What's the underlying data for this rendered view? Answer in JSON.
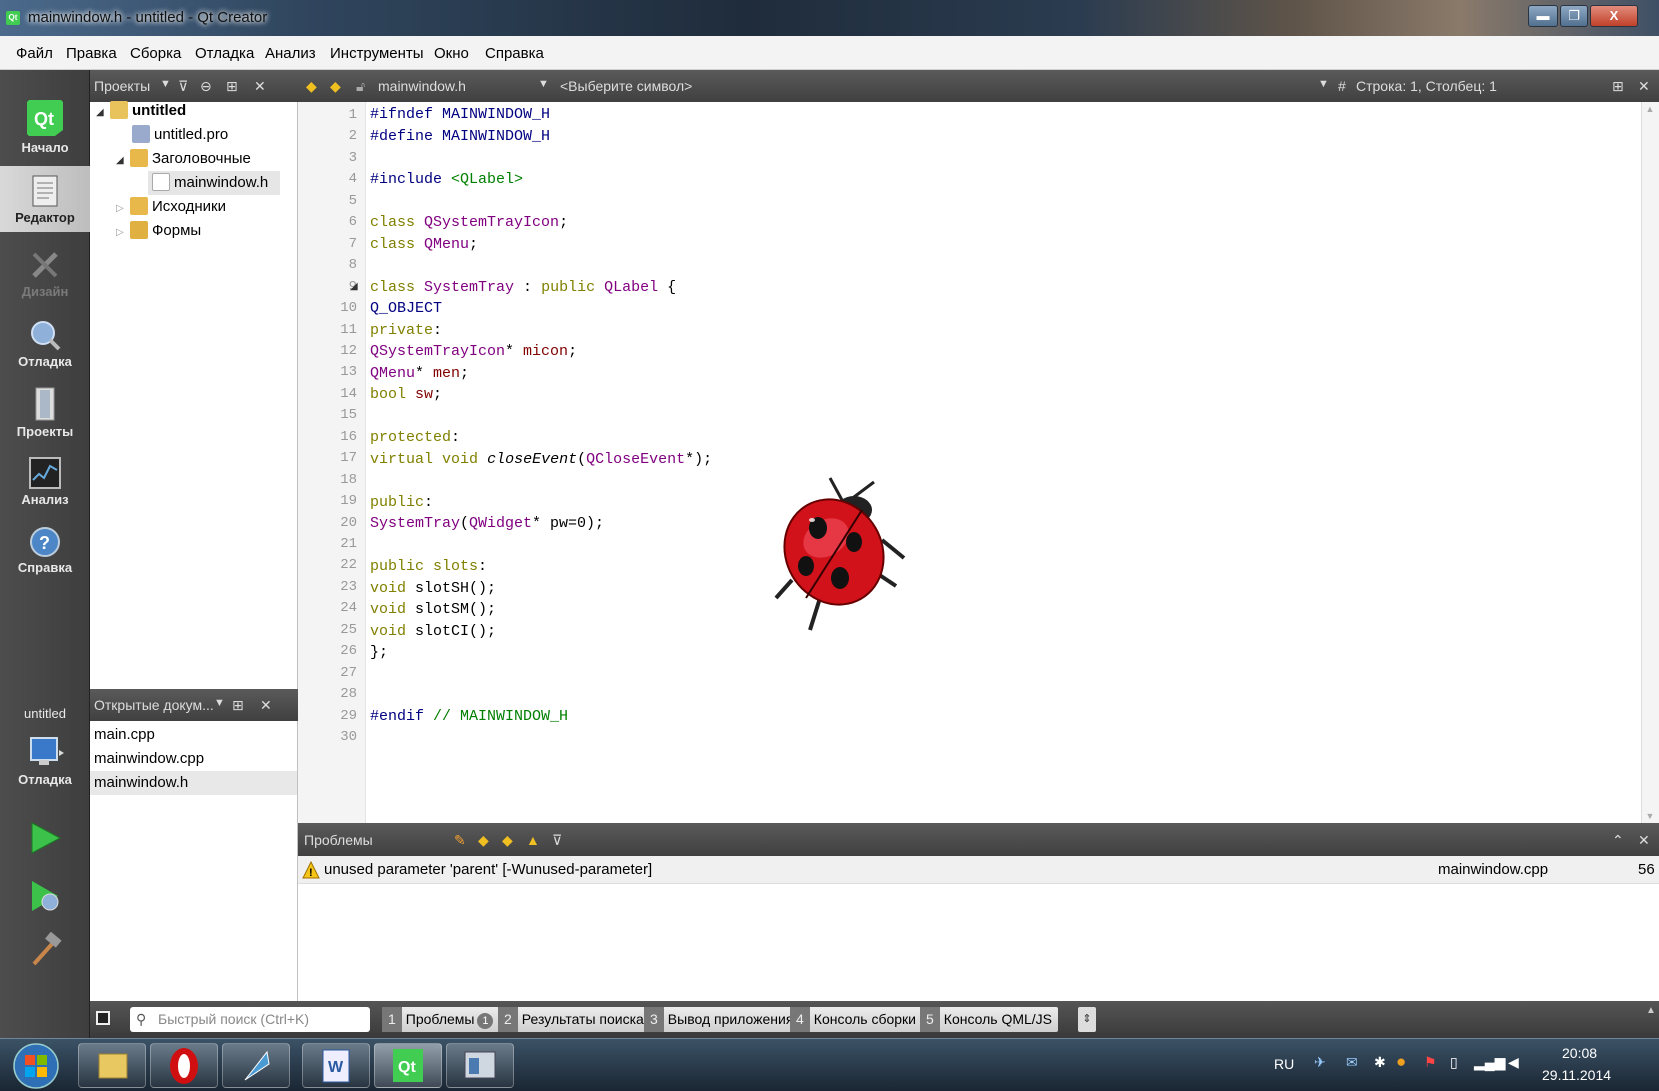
{
  "window": {
    "title": "mainwindow.h - untitled - Qt Creator",
    "min_label": "▬",
    "max_label": "❐",
    "close_label": "X"
  },
  "menu": [
    "Файл",
    "Правка",
    "Сборка",
    "Отладка",
    "Анализ",
    "Инструменты",
    "Окно",
    "Справка"
  ],
  "modes": {
    "start": "Начало",
    "editor": "Редактор",
    "design": "Дизайн",
    "debug": "Отладка",
    "projects": "Проекты",
    "analyze": "Анализ",
    "help": "Справка",
    "kit_project": "untitled",
    "kit_config": "Отладка"
  },
  "projects_panel": {
    "title": "Проекты",
    "tree": [
      {
        "label": "untitled",
        "level": 0,
        "icon": "qt-project-icon"
      },
      {
        "label": "untitled.pro",
        "level": 1,
        "icon": "pro-file-icon"
      },
      {
        "label": "Заголовочные",
        "level": 1,
        "icon": "headers-folder-icon"
      },
      {
        "label": "mainwindow.h",
        "level": 2,
        "icon": "header-file-icon"
      },
      {
        "label": "Исходники",
        "level": 1,
        "icon": "sources-folder-icon"
      },
      {
        "label": "Формы",
        "level": 1,
        "icon": "forms-folder-icon"
      }
    ]
  },
  "open_documents": {
    "title": "Открытые докум...",
    "items": [
      "main.cpp",
      "mainwindow.cpp",
      "mainwindow.h"
    ],
    "selected": 2
  },
  "editor": {
    "file": "mainwindow.h",
    "symbol": "<Выберите символ>",
    "position": "Строка: 1, Столбец: 1",
    "line_count": 30
  },
  "code": {
    "l1": [
      "#ifndef",
      " MAINWINDOW_H"
    ],
    "l2": [
      "#define",
      " MAINWINDOW_H"
    ],
    "l4": [
      "#include",
      " ",
      "<QLabel>"
    ],
    "l6": [
      "class",
      " ",
      "QSystemTrayIcon",
      ";"
    ],
    "l7": [
      "class",
      " ",
      "QMenu",
      ";"
    ],
    "l9": [
      "class",
      " ",
      "SystemTray",
      " : ",
      "public",
      " ",
      "QLabel",
      " {"
    ],
    "l10": [
      "Q_OBJECT"
    ],
    "l11": [
      "private",
      ":"
    ],
    "l12": [
      "QSystemTrayIcon",
      "* ",
      "micon",
      ";"
    ],
    "l13": [
      "QMenu",
      "* ",
      "men",
      ";"
    ],
    "l14": [
      "bool",
      " ",
      "sw",
      ";"
    ],
    "l16": [
      "protected",
      ":"
    ],
    "l17": [
      "virtual",
      " ",
      "void",
      " ",
      "closeEvent",
      "(",
      "QCloseEvent",
      "*);"
    ],
    "l19": [
      "public",
      ":"
    ],
    "l20": [
      "SystemTray",
      "(",
      "QWidget",
      "* pw=0);"
    ],
    "l22": [
      "public",
      " ",
      "slots",
      ":"
    ],
    "l23": [
      "void",
      " slotSH();"
    ],
    "l24": [
      "void",
      " slotSM();"
    ],
    "l25": [
      "void",
      " slotCI();"
    ],
    "l26": [
      "};"
    ],
    "l29": [
      "#endif",
      " ",
      "// MAINWINDOW_H"
    ]
  },
  "problems": {
    "title": "Проблемы",
    "message": "unused parameter 'parent' [-Wunused-parameter]",
    "file": "mainwindow.cpp",
    "line": "56"
  },
  "output_bar": {
    "search_placeholder": "Быстрый поиск (Ctrl+K)",
    "tabs": [
      {
        "num": "1",
        "label": "Проблемы",
        "badge": "1"
      },
      {
        "num": "2",
        "label": "Результаты поиска"
      },
      {
        "num": "3",
        "label": "Вывод приложения"
      },
      {
        "num": "4",
        "label": "Консоль сборки"
      },
      {
        "num": "5",
        "label": "Консоль QML/JS"
      }
    ]
  },
  "taskbar": {
    "lang": "RU",
    "time": "20:08",
    "date": "29.11.2014"
  },
  "colors": {
    "keyword": "#808000",
    "type": "#800080",
    "preproc": "#000080",
    "string": "#008000",
    "qt_green": "#41cd52"
  }
}
